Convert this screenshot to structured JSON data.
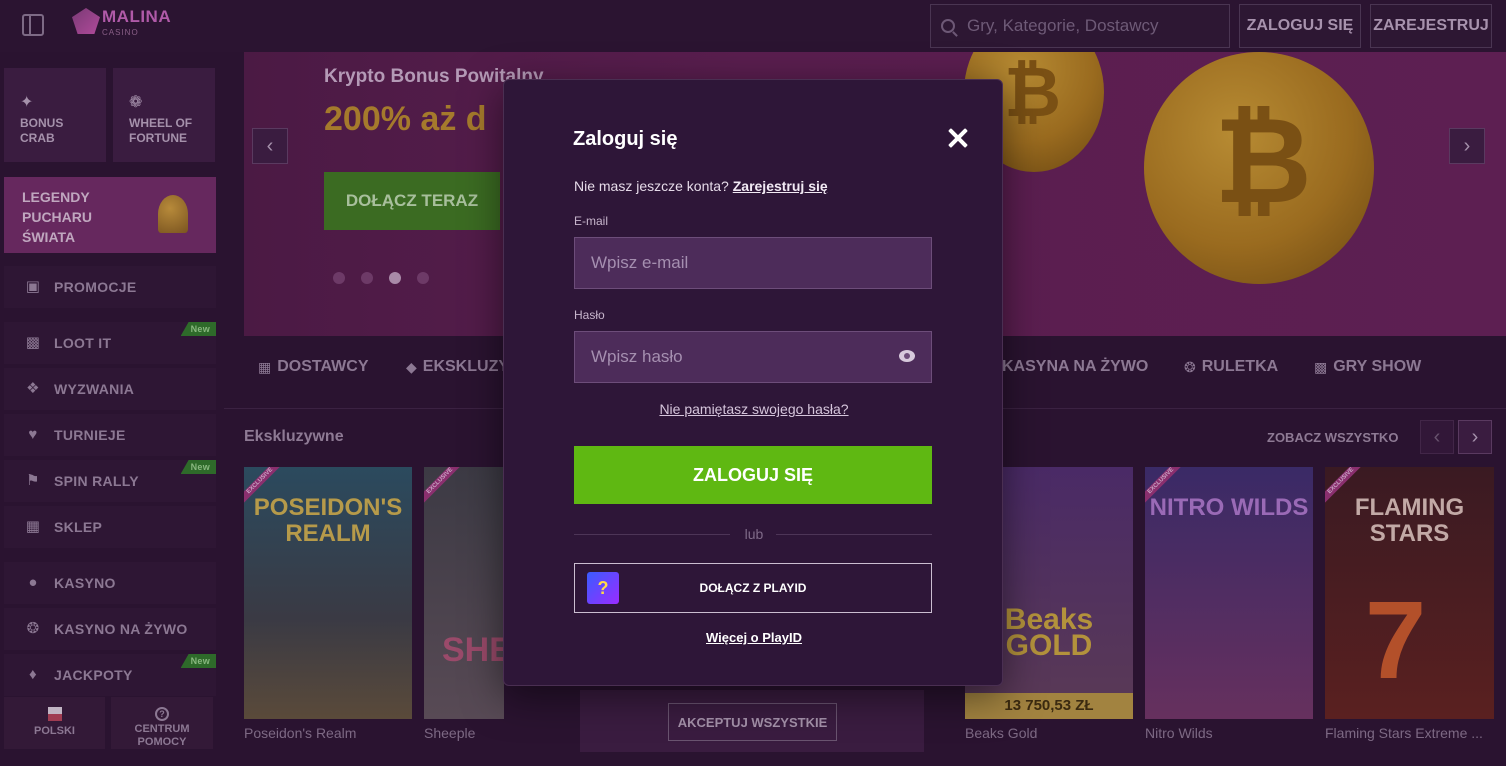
{
  "header": {
    "logo_text": "MALINA",
    "logo_sub": "CASINO",
    "search_placeholder": "Gry, Kategorie, Dostawcy",
    "login_label": "ZALOGUJ SIĘ",
    "register_label": "ZAREJESTRUJ"
  },
  "sidebar": {
    "tiles": [
      {
        "label": "BONUS CRAB",
        "icon": "crab-icon"
      },
      {
        "label": "WHEEL OF FORTUNE",
        "icon": "wheel-icon"
      }
    ],
    "promo": {
      "label": "LEGENDY PUCHARU ŚWIATA"
    },
    "items": [
      {
        "label": "PROMOCJE",
        "icon": "gift-icon",
        "badge": ""
      },
      {
        "label": "LOOT IT",
        "icon": "chest-icon",
        "badge": "New"
      },
      {
        "label": "WYZWANIA",
        "icon": "badge-icon",
        "badge": ""
      },
      {
        "label": "TURNIEJE",
        "icon": "cup-icon",
        "badge": ""
      },
      {
        "label": "SPIN RALLY",
        "icon": "flag-icon",
        "badge": "New"
      },
      {
        "label": "SKLEP",
        "icon": "shop-icon",
        "badge": ""
      },
      {
        "label": "KASYNO",
        "icon": "cherry-icon",
        "badge": ""
      },
      {
        "label": "KASYNO NA ŻYWO",
        "icon": "chip-icon",
        "badge": ""
      },
      {
        "label": "JACKPOTY",
        "icon": "jackpot-icon",
        "badge": "New"
      }
    ],
    "language_label": "POLSKI",
    "help_label": "CENTRUM POMOCY"
  },
  "banner": {
    "subtitle": "Krypto Bonus Powitalny",
    "headline": "200% aż d",
    "cta_label": "DOŁĄCZ TERAZ",
    "slides_total": 4,
    "active_slide": 3
  },
  "categories": [
    {
      "label": "DOSTAWCY",
      "icon": "grid-icon"
    },
    {
      "label": "EKSKLUZY",
      "icon": "diamond-icon"
    },
    {
      "label": "KASYNA NA ŻYWO",
      "icon": ""
    },
    {
      "label": "RULETKA",
      "icon": "roulette-icon"
    },
    {
      "label": "GRY SHOW",
      "icon": "show-icon"
    }
  ],
  "games_section": {
    "title": "Ekskluzywne",
    "see_all": "ZOBACZ WSZYSTKO",
    "exclusive_tag": "EXCLUSIVE",
    "games": [
      {
        "name": "Poseidon's Realm",
        "art_title": "POSEIDON'S REALM",
        "jackpot": ""
      },
      {
        "name": "Sheeple",
        "art_title": "SHE",
        "jackpot": ""
      },
      {
        "name": "Beaks Gold",
        "art_title": "Beaks GOLD",
        "jackpot": "13 750,53 ZŁ"
      },
      {
        "name": "Nitro Wilds",
        "art_title": "NITRO WILDS",
        "jackpot": ""
      },
      {
        "name": "Flaming Stars Extreme ...",
        "art_title": "FLAMING STARS",
        "jackpot": ""
      }
    ]
  },
  "cookie": {
    "accept_label": "AKCEPTUJ WSZYSTKIE"
  },
  "modal": {
    "title": "Zaloguj się",
    "no_account_text": "Nie masz jeszcze konta?",
    "register_link": "Zarejestruj się",
    "email_label": "E-mail",
    "email_placeholder": "Wpisz e-mail",
    "password_label": "Hasło",
    "password_placeholder": "Wpisz hasło",
    "forgot_password": "Nie pamiętasz swojego hasła?",
    "login_button": "ZALOGUJ SIĘ",
    "or_text": "lub",
    "playid_button": "DOŁĄCZ Z PLAYID",
    "more_playid": "Więcej o PlayID"
  },
  "colors": {
    "accent_green": "#5fb812",
    "modal_bg": "#2e1638",
    "page_bg": "#2a1330"
  }
}
